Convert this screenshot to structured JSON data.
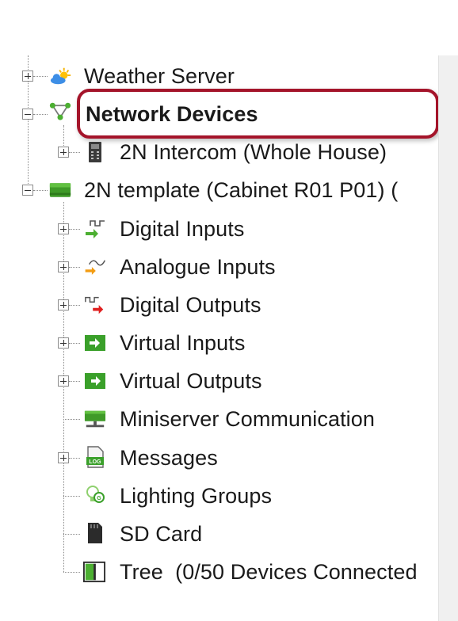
{
  "tree": {
    "items": [
      {
        "label": "Weather Server",
        "icon": "weather-icon"
      },
      {
        "label": "Network Devices",
        "icon": "network-icon"
      },
      {
        "label": "2N Intercom (Whole House)",
        "icon": "intercom-icon"
      },
      {
        "label": "2N template (Cabinet R01 P01) (",
        "icon": "miniserver-icon"
      },
      {
        "label": "Digital Inputs",
        "icon": "digital-inputs-icon"
      },
      {
        "label": "Analogue Inputs",
        "icon": "analogue-inputs-icon"
      },
      {
        "label": "Digital Outputs",
        "icon": "digital-outputs-icon"
      },
      {
        "label": "Virtual Inputs",
        "icon": "virtual-inputs-icon"
      },
      {
        "label": "Virtual Outputs",
        "icon": "virtual-outputs-icon"
      },
      {
        "label": "Miniserver Communication",
        "icon": "communication-icon"
      },
      {
        "label": "Messages",
        "icon": "messages-icon"
      },
      {
        "label": "Lighting Groups",
        "icon": "lighting-groups-icon"
      },
      {
        "label": "SD Card",
        "icon": "sd-card-icon"
      },
      {
        "label": "Tree  (0/50 Devices Connected",
        "icon": "tree-icon"
      }
    ]
  },
  "colors": {
    "highlight": "#a4142a",
    "green": "#4caf32",
    "orange": "#f39c12",
    "red": "#e02020"
  }
}
